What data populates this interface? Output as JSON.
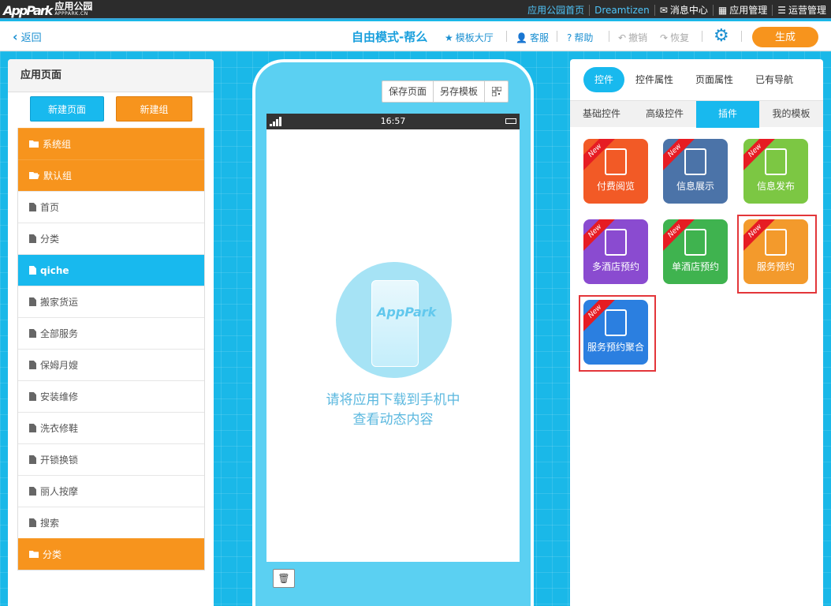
{
  "topbar": {
    "logo_mark": "AppPark",
    "logo_cn": "应用公园",
    "logo_en": "APPPARK.CN",
    "nav": [
      {
        "label": "应用公园首页"
      },
      {
        "label": "Dreamtizen"
      },
      {
        "label": "消息中心",
        "icon": "mail-icon"
      },
      {
        "label": "应用管理",
        "icon": "grid-icon"
      },
      {
        "label": "运营管理",
        "icon": "list-icon"
      }
    ]
  },
  "toolbar": {
    "back": "返回",
    "mode_title": "自由模式-帮么",
    "template_hall": "模板大厅",
    "service": "客服",
    "help": "帮助",
    "undo": "撤销",
    "redo": "恢复",
    "generate": "生成"
  },
  "left": {
    "title": "应用页面",
    "new_page": "新建页面",
    "new_group": "新建组",
    "items": [
      {
        "label": "系统组",
        "type": "group"
      },
      {
        "label": "默认组",
        "type": "group-open"
      },
      {
        "label": "首页",
        "type": "page"
      },
      {
        "label": "分类",
        "type": "page"
      },
      {
        "label": "qiche",
        "type": "active"
      },
      {
        "label": "搬家货运",
        "type": "page"
      },
      {
        "label": "全部服务",
        "type": "page"
      },
      {
        "label": "保姆月嫂",
        "type": "page"
      },
      {
        "label": "安装维修",
        "type": "page"
      },
      {
        "label": "洗衣修鞋",
        "type": "page"
      },
      {
        "label": "开锁换锁",
        "type": "page"
      },
      {
        "label": "丽人按摩",
        "type": "page"
      },
      {
        "label": "搜索",
        "type": "page"
      },
      {
        "label": "分类",
        "type": "group"
      }
    ]
  },
  "phone": {
    "save_page": "保存页面",
    "save_template": "另存模板",
    "time": "16:57",
    "line1": "请将应用下载到手机中",
    "line2": "查看动态内容",
    "trash": "🗑"
  },
  "right": {
    "tabs": [
      "控件",
      "控件属性",
      "页面属性",
      "已有导航"
    ],
    "subtabs": [
      "基础控件",
      "高级控件",
      "插件",
      "我的模板"
    ],
    "new_badge": "New",
    "tiles": [
      {
        "label": "付费阅览",
        "color": "#f25a26",
        "icon": "paid-doc-icon"
      },
      {
        "label": "信息展示",
        "color": "#4b73a8",
        "icon": "layers-doc-icon"
      },
      {
        "label": "信息发布",
        "color": "#7cc743",
        "icon": "upload-doc-icon"
      },
      {
        "label": "多酒店预约",
        "color": "#8a4bd0",
        "icon": "hotels-icon"
      },
      {
        "label": "单酒店预约",
        "color": "#3fb34f",
        "icon": "hotel-icon"
      },
      {
        "label": "服务预约",
        "color": "#f39a2c",
        "icon": "calendar-icon"
      },
      {
        "label": "服务预约聚合",
        "color": "#2b7fe0",
        "icon": "calendar-plus-icon"
      }
    ]
  }
}
